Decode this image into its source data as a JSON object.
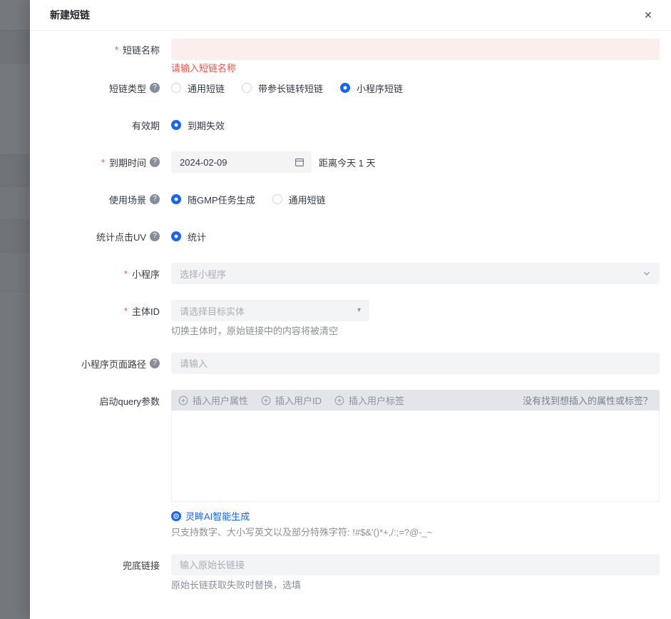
{
  "ui": {
    "required_mark": "*",
    "help_mark": "?",
    "close_glyph": "✕",
    "caret_glyph": "▾"
  },
  "colors": {
    "accent_blue": "#1664ff",
    "error_red": "#f1554e",
    "error_bg": "#fdeeee",
    "input_bg": "#f3f4f6",
    "toolbar_bg": "#e2e5e9"
  },
  "drawer": {
    "title": "新建短链"
  },
  "form": {
    "name": {
      "label": "短链名称",
      "value": "",
      "error": "请输入短链名称"
    },
    "type": {
      "label": "短链类型",
      "options": [
        {
          "label": "通用短链",
          "checked": false
        },
        {
          "label": "带参长链转短链",
          "checked": false
        },
        {
          "label": "小程序短链",
          "checked": true
        }
      ]
    },
    "validity": {
      "label": "有效期",
      "options": [
        {
          "label": "到期失效",
          "checked": true
        }
      ]
    },
    "expire": {
      "label": "到期时间",
      "value": "2024-02-09",
      "note": "距离今天 1 天"
    },
    "scene": {
      "label": "使用场景",
      "options": [
        {
          "label": "随GMP任务生成",
          "checked": true
        },
        {
          "label": "通用短链",
          "checked": false
        }
      ]
    },
    "uv": {
      "label": "统计点击UV",
      "options": [
        {
          "label": "统计",
          "checked": true
        }
      ]
    },
    "miniprogram": {
      "label": "小程序",
      "placeholder": "选择小程序"
    },
    "entity": {
      "label": "主体ID",
      "placeholder": "请选择目标实体",
      "hint": "切换主体时，原始链接中的内容将被清空"
    },
    "page_path": {
      "label": "小程序页面路径",
      "placeholder": "请输入"
    },
    "query": {
      "label": "启动query参数",
      "insert_buttons": [
        {
          "label": "插入用户属性"
        },
        {
          "label": "插入用户ID"
        },
        {
          "label": "插入用户标签"
        }
      ],
      "not_found_link": "没有找到想插入的属性或标签？",
      "value": "",
      "ai_link": "灵眸AI智能生成",
      "hint": "只支持数字、大小写英文以及部分特殊字符: !#$&'()*+,/:;=?@-_~"
    },
    "fallback": {
      "label": "兜底链接",
      "placeholder": "输入原始长链接",
      "hint": "原始长链获取失败时替换，选填"
    }
  }
}
